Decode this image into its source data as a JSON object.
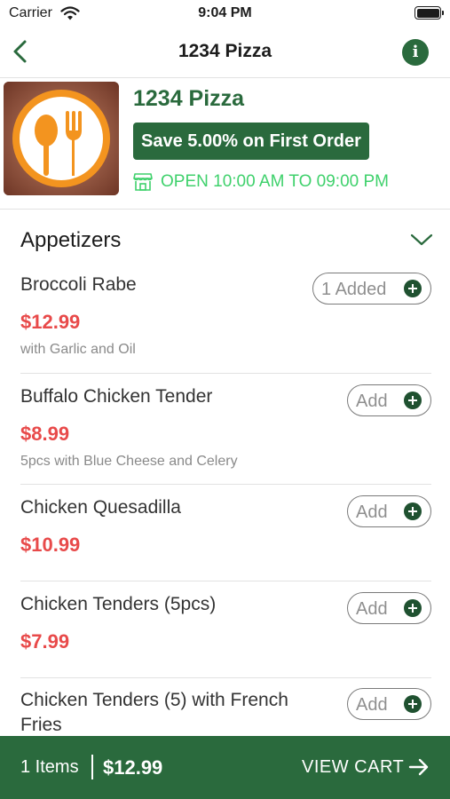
{
  "status_bar": {
    "carrier": "Carrier",
    "time": "9:04 PM",
    "wifi_icon": "wifi-icon",
    "battery_icon": "battery-icon"
  },
  "nav": {
    "back_icon": "chevron-left-icon",
    "title": "1234 Pizza",
    "info_icon": "info-icon",
    "info_glyph": "i"
  },
  "restaurant": {
    "name": "1234 Pizza",
    "promo": "Save 5.00% on First Order",
    "hours": "OPEN 10:00 AM TO 09:00 PM",
    "hours_icon": "storefront-icon",
    "logo_icon": "spoon-fork-icon"
  },
  "menu": {
    "category": "Appetizers",
    "category_icon": "chevron-down-icon",
    "items": [
      {
        "name": "Broccoli Rabe",
        "price": "$12.99",
        "description": "with Garlic and Oil",
        "button": "1 Added"
      },
      {
        "name": "Buffalo Chicken Tender",
        "price": "$8.99",
        "description": "5pcs with Blue Cheese and Celery",
        "button": "Add"
      },
      {
        "name": "Chicken Quesadilla",
        "price": "$10.99",
        "description": "",
        "button": "Add"
      },
      {
        "name": "Chicken Tenders (5pcs)",
        "price": "$7.99",
        "description": "",
        "button": "Add"
      },
      {
        "name": "Chicken Tenders (5) with French Fries",
        "price": "",
        "description": "",
        "button": "Add"
      }
    ]
  },
  "cart": {
    "items": "1 Items",
    "total": "$12.99",
    "view_label": "VIEW CART",
    "arrow_icon": "arrow-right-icon"
  },
  "colors": {
    "brand_green": "#2a6a3d",
    "open_green": "#3fd16c",
    "price_red": "#e84a4a",
    "plus_green": "#1f5130"
  }
}
